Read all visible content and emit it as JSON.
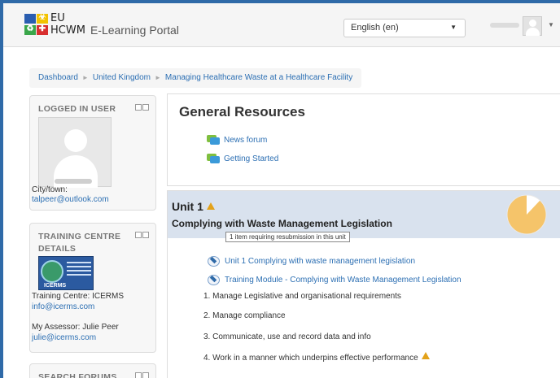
{
  "header": {
    "logo_eu": "EU",
    "logo_hcwm": "HCWM",
    "portal_title": "E-Learning Portal",
    "language": "English (en)"
  },
  "breadcrumb": [
    "Dashboard",
    "United Kingdom",
    "Managing Healthcare Waste at a Healthcare Facility"
  ],
  "logged_in": {
    "title": "LOGGED IN USER",
    "city_label": "City/town:",
    "email": "talpeer@outlook.com"
  },
  "training_centre": {
    "title": "TRAINING CENTRE DETAILS",
    "logo_text": "ICERMS",
    "centre": "Training Centre: ICERMS",
    "centre_email": "info@icerms.com",
    "assessor": "My Assessor: Julie Peer",
    "assessor_email": "julie@icerms.com"
  },
  "search_forums": {
    "title": "SEARCH FORUMS"
  },
  "general": {
    "title": "General Resources",
    "activities": [
      "News forum",
      "Getting Started"
    ]
  },
  "unit": {
    "title": "Unit 1",
    "subtitle": "Complying with Waste Management Legislation",
    "tooltip": "1 item requiring resubmission in this unit",
    "progress": 0.88,
    "activities": [
      "Unit 1 Complying with waste management legislation",
      "Training Module - Complying with Waste Management Legislation"
    ],
    "items": [
      "1. Manage Legislative and organisational requirements",
      "2. Manage compliance",
      "3. Communicate, use and record data and info",
      "4. Work in a manner which underpins effective performance"
    ]
  },
  "colors": {
    "link": "#2c6fb3",
    "unit_header": "#d9e2ee",
    "pie": "#f5c46a",
    "warning": "#e3a21a"
  }
}
